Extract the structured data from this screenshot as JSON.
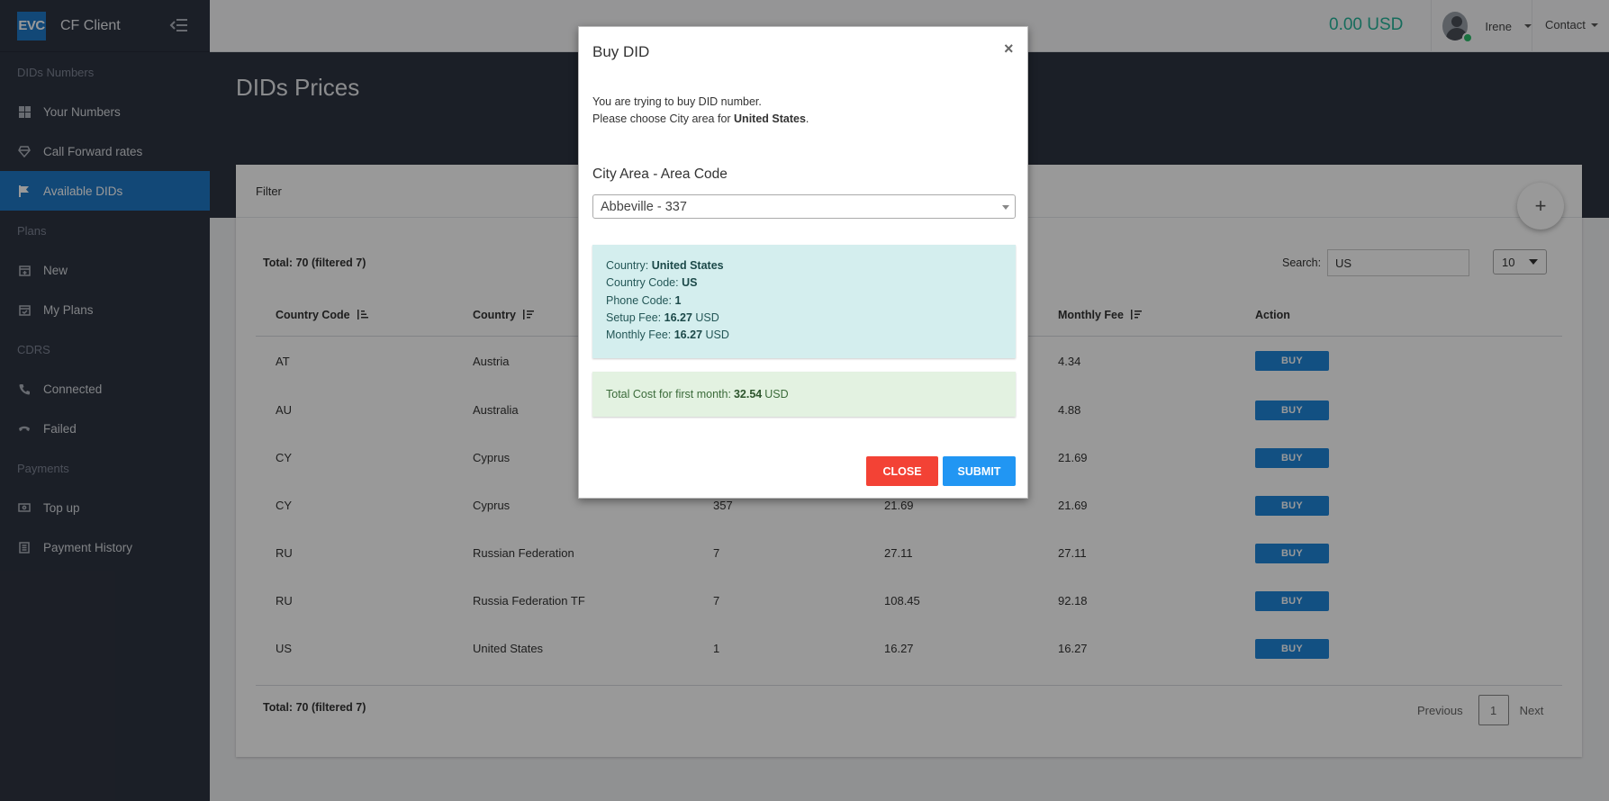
{
  "app": {
    "logo": "EVC",
    "name": "CF Client"
  },
  "sidebar": {
    "sections": [
      {
        "title": "DIDs Numbers",
        "items": [
          {
            "label": "Your Numbers",
            "icon": "grid-icon"
          },
          {
            "label": "Call Forward rates",
            "icon": "diamond-icon"
          },
          {
            "label": "Available DIDs",
            "icon": "flag-icon",
            "active": true
          }
        ]
      },
      {
        "title": "Plans",
        "items": [
          {
            "label": "New",
            "icon": "calendar-plus-icon"
          },
          {
            "label": "My Plans",
            "icon": "calendar-check-icon"
          }
        ]
      },
      {
        "title": "CDRS",
        "items": [
          {
            "label": "Connected",
            "icon": "phone-icon"
          },
          {
            "label": "Failed",
            "icon": "phone-hangup-icon"
          }
        ]
      },
      {
        "title": "Payments",
        "items": [
          {
            "label": "Top up",
            "icon": "money-icon"
          },
          {
            "label": "Payment History",
            "icon": "list-icon"
          }
        ]
      }
    ]
  },
  "topbar": {
    "balance": "0.00 USD",
    "user": "Irene",
    "contact": "Contact"
  },
  "page": {
    "title": "DIDs Prices",
    "filter": "Filter"
  },
  "table": {
    "total_top": "Total: 70 (filtered 7)",
    "total_bottom": "Total: 70 (filtered 7)",
    "search_label": "Search:",
    "search_value": "US",
    "page_size": "10",
    "headers": [
      "Country Code",
      "Country",
      "",
      "",
      "Monthly Fee",
      "Action"
    ],
    "buy_label": "BUY",
    "rows": [
      [
        "AT",
        "Austria",
        "",
        "",
        "4.34"
      ],
      [
        "AU",
        "Australia",
        "",
        "",
        "4.88"
      ],
      [
        "CY",
        "Cyprus",
        "",
        "",
        "21.69"
      ],
      [
        "CY",
        "Cyprus",
        "357",
        "21.69",
        "21.69"
      ],
      [
        "RU",
        "Russian Federation",
        "7",
        "27.11",
        "27.11"
      ],
      [
        "RU",
        "Russia Federation TF",
        "7",
        "108.45",
        "92.18"
      ],
      [
        "US",
        "United States",
        "1",
        "16.27",
        "16.27"
      ]
    ],
    "pager": {
      "previous": "Previous",
      "page": "1",
      "next": "Next"
    }
  },
  "modal": {
    "title": "Buy DID",
    "line1": "You are trying to buy DID number.",
    "line2_prefix": "Please choose City area for ",
    "line2_country": "United States",
    "line2_suffix": ".",
    "field_label": "City Area - Area Code",
    "selected_area": "Abbeville - 337",
    "info": {
      "country_label": "Country: ",
      "country": "United States",
      "code_label": "Country Code: ",
      "code": "US",
      "phone_label": "Phone Code: ",
      "phone": "1",
      "setup_label": "Setup Fee: ",
      "setup": "16.27",
      "setup_unit": " USD",
      "monthly_label": "Monthly Fee: ",
      "monthly": "16.27",
      "monthly_unit": " USD"
    },
    "total_label": "Total Cost for first month:",
    "total_value": "32.54",
    "total_unit": "USD",
    "close_label": "CLOSE",
    "submit_label": "SUBMIT"
  }
}
